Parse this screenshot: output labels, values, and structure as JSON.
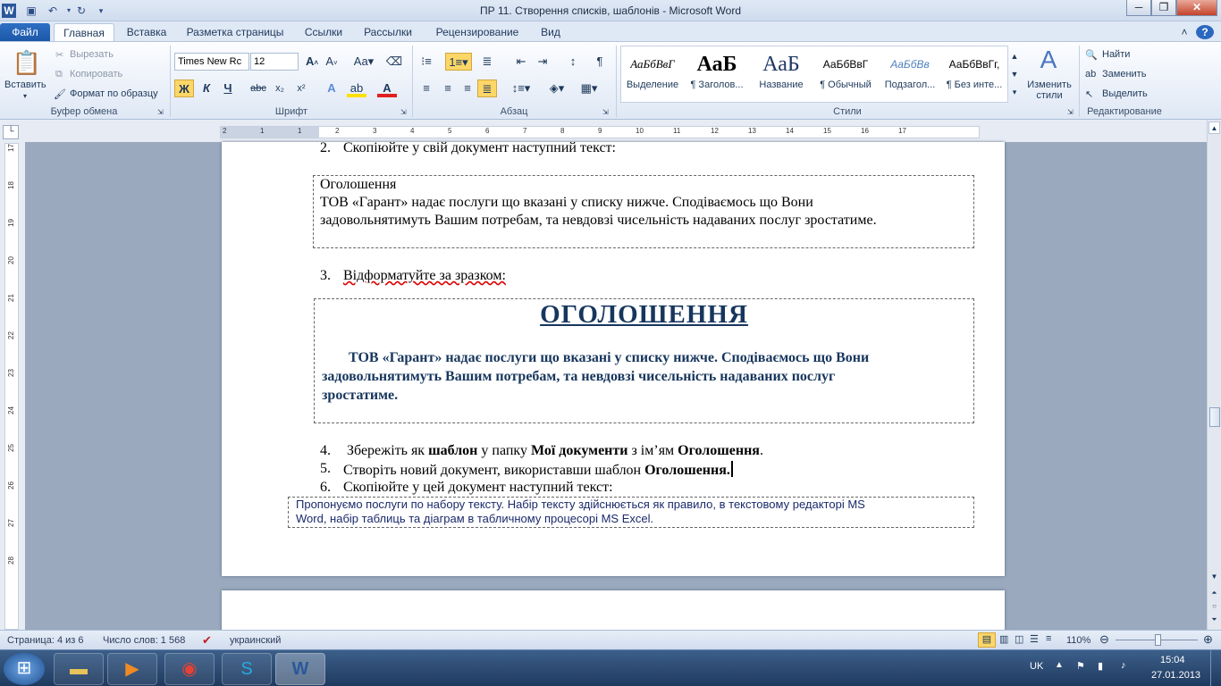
{
  "window": {
    "title": "ПР 11. Створення списків, шаблонів  -  Microsoft Word"
  },
  "tabs": [
    "Файл",
    "Главная",
    "Вставка",
    "Разметка страницы",
    "Ссылки",
    "Рассылки",
    "Рецензирование",
    "Вид"
  ],
  "clipboard": {
    "paste": "Вставить",
    "cut": "Вырезать",
    "copy": "Копировать",
    "format_painter": "Формат по образцу",
    "label": "Буфер обмена"
  },
  "font": {
    "name": "Times New Rc",
    "size": "12",
    "bold": "Ж",
    "italic": "К",
    "underline": "Ч",
    "strike": "abc",
    "sub": "x₂",
    "sup": "x²",
    "label": "Шрифт"
  },
  "paragraph": {
    "label": "Абзац"
  },
  "styles": {
    "items": [
      {
        "preview": "АаБбВвГ",
        "name": "Выделение"
      },
      {
        "preview": "АаБ",
        "name": "¶ Заголов..."
      },
      {
        "preview": "АаБ",
        "name": "Название"
      },
      {
        "preview": "АаБбВвГ",
        "name": "¶ Обычный"
      },
      {
        "preview": "АаБбВв",
        "name": "Подзагол..."
      },
      {
        "preview": "АаБбВвГг,",
        "name": "¶ Без инте..."
      }
    ],
    "change": "Изменить стили",
    "label": "Стили"
  },
  "editing": {
    "find": "Найти",
    "replace": "Заменить",
    "select": "Выделить",
    "label": "Редактирование"
  },
  "ruler_h": [
    "2",
    "1",
    "1",
    "2",
    "3",
    "4",
    "5",
    "6",
    "7",
    "8",
    "9",
    "10",
    "11",
    "12",
    "13",
    "14",
    "15",
    "16",
    "17"
  ],
  "ruler_v": [
    "17",
    "18",
    "19",
    "20",
    "21",
    "22",
    "23",
    "24",
    "25",
    "26",
    "27",
    "28"
  ],
  "document": {
    "item2": {
      "num": "2.",
      "text": "Скопіюйте у свій документ наступний текст:"
    },
    "box1": {
      "title": "Оголошення",
      "line1": " ТОВ  «Гарант»  надає  послуги  що  вказані  у  списку  нижче.  Сподіваємось  що  Вони",
      "line2": "задовольнятимуть Вашим потребам, та невдовзі чисельність надаваних послуг зростатиме."
    },
    "item3": {
      "num": "3.",
      "text": "Відформатуйте за зразком:"
    },
    "box2": {
      "heading": "ОГОЛОШЕННЯ",
      "line1": "ТОВ  «Гарант»  надає  послуги  що  вказані  у  списку  нижче.  Сподіваємось  що  Вони",
      "line2": "задовольнятимуть   Вашим   потребам,   та   невдовзі   чисельність   надаваних   послуг",
      "line3": "зростатиме."
    },
    "item4": {
      "num": "4.",
      "pre": "Збережіть як ",
      "b1": "шаблон",
      "mid1": " у папку ",
      "b2": "Мої документи",
      "mid2": " з ім’ям ",
      "b3": "Оголошення",
      "end": "."
    },
    "item5": {
      "num": "5.",
      "pre": "Створіть новий документ, використавши шаблон ",
      "b1": "Оголошення."
    },
    "item6": {
      "num": "6.",
      "text": "Скопіюйте у цей документ наступний текст:"
    },
    "box3": {
      "line1": "Пропонуємо послуги по набору тексту. Набір тексту здійснюється як правило, в текстовому редакторі MS",
      "line2": "Word, набір таблиць та діаграм в табличному процесорі MS Excel."
    }
  },
  "status": {
    "page": "Страница: 4 из 6",
    "words": "Число слов: 1 568",
    "language": "украинский",
    "zoom": "110%"
  },
  "taskbar": {
    "lang": "UK",
    "time": "15:04",
    "date": "27.01.2013"
  }
}
